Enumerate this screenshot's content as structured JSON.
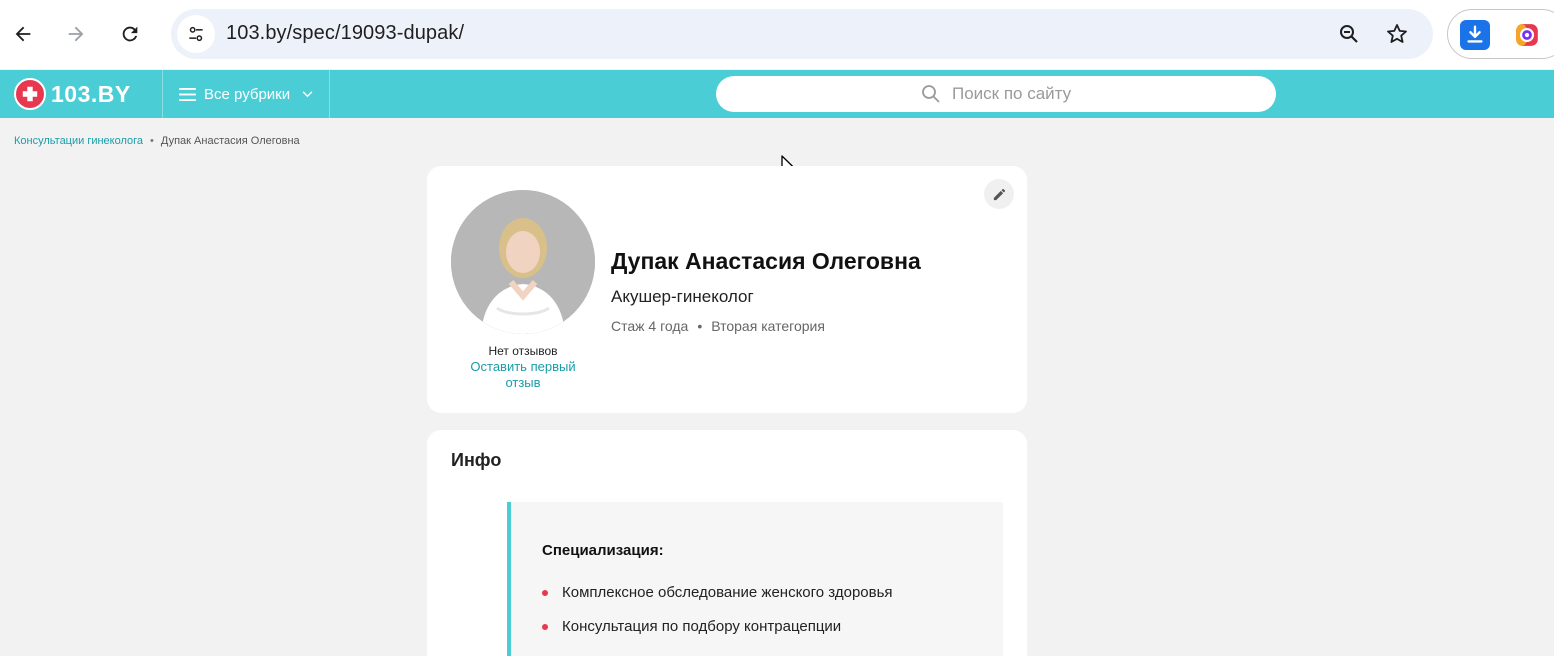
{
  "browser": {
    "url": "103.by/spec/19093-dupak/"
  },
  "header": {
    "logo_text": "103.BY",
    "rubrics_label": "Все рубрики",
    "search_placeholder": "Поиск по сайту"
  },
  "breadcrumb": {
    "items": [
      "Консультации гинеколога",
      "Дупак Анастасия Олеговна"
    ]
  },
  "profile": {
    "name": "Дупак Анастасия Олеговна",
    "specialty": "Акушер-гинеколог",
    "experience": "Стаж 4 года",
    "category": "Вторая категория",
    "reviews_none": "Нет отзывов",
    "reviews_link": "Оставить первый отзыв"
  },
  "info": {
    "title": "Инфо",
    "spec_heading": "Специализация:",
    "spec_items": [
      "Комплексное обследование женского здоровья",
      "Консультация по подбору контрацепции"
    ]
  },
  "colors": {
    "accent": "#4bcdd6",
    "brand_red": "#e8384f",
    "link": "#1a9ea8"
  }
}
